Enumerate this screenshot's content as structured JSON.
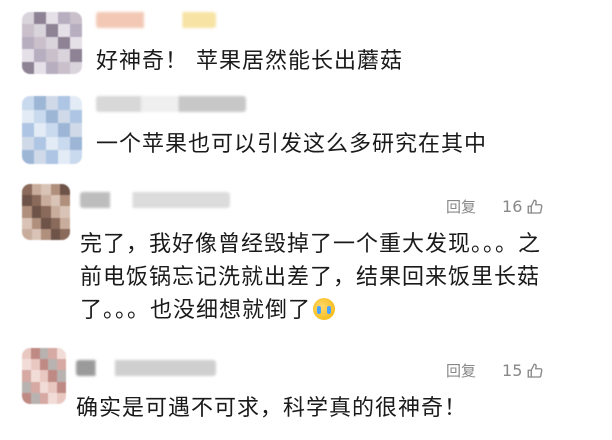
{
  "comments": [
    {
      "text_lines": [
        "好神奇！ 苹果居然能长出蘑菇"
      ],
      "avatar_colors": [
        "#d9d3dc",
        "#b7aebf",
        "#8d8395",
        "#c9c0cb",
        "#e5e0e8"
      ],
      "name_colors": [
        "#f3c9b6",
        "#f7e3a4"
      ]
    },
    {
      "text_lines": [
        "一个苹果也可以引发这么多研究在其中"
      ],
      "avatar_colors": [
        "#c9d9ee",
        "#aec5e3",
        "#9db6d6",
        "#e2ebf6",
        "#cfd9e8"
      ],
      "name_colors": [
        "#d8d8d8",
        "#c8c8c8"
      ]
    },
    {
      "text_lines": [
        "完了，我好像曾经毁掉了一个重大发现。。。之",
        "前电饭锅忘记洗就出差了，结果回来饭里长菇",
        "了。。。也没细想就倒了"
      ],
      "emoji": "crying-face-icon",
      "reply_label": "回复",
      "like_count": "16",
      "avatar_colors": [
        "#8a6a5a",
        "#b08f7d",
        "#c9ad9c",
        "#6e5448",
        "#d8c3b6"
      ],
      "name_colors": [
        "#bdbdbd",
        "#dcdcdc"
      ]
    },
    {
      "text_lines": [
        "确实是可遇不可求，科学真的很神奇！"
      ],
      "reply_label": "回复",
      "like_count": "15",
      "avatar_colors": [
        "#e9c8c2",
        "#d6a9a2",
        "#c08a84",
        "#f2dcd8",
        "#b8b2b0"
      ],
      "name_colors": [
        "#9a9a9a",
        "#cfcfcf"
      ]
    }
  ],
  "colors": {
    "text": "#1a1a1a",
    "meta": "#888888"
  }
}
